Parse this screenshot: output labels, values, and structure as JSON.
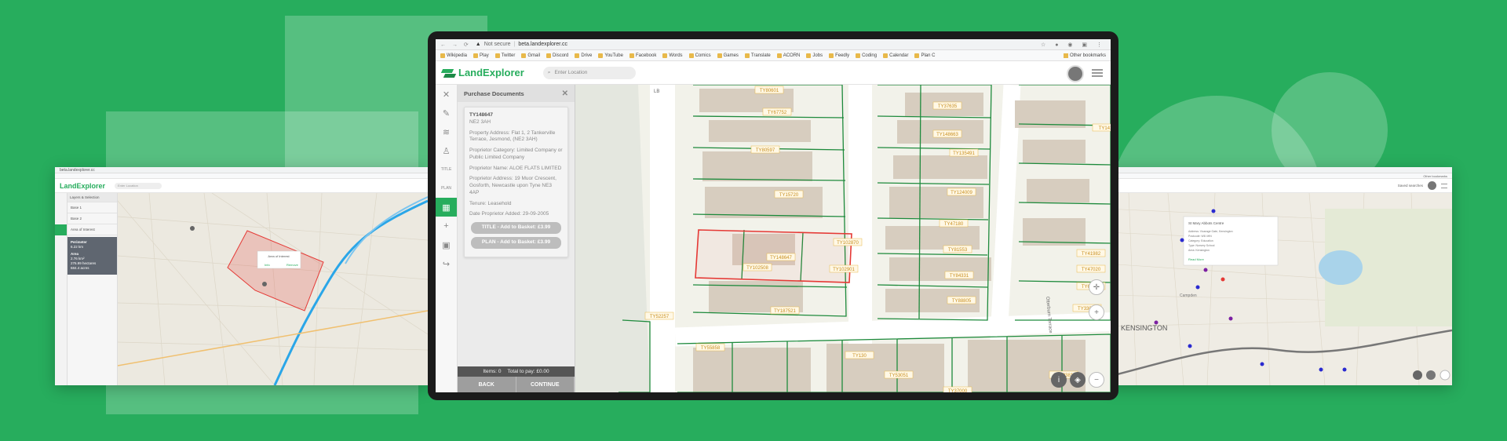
{
  "colors": {
    "brand_green": "#27ad5d",
    "parcel_green": "#1e8a3c",
    "selected_red": "#e53935"
  },
  "browser": {
    "security_label": "Not secure",
    "url": "beta.landexplorer.cc",
    "bookmarks": [
      "Wikipedia",
      "Play",
      "Twitter",
      "Gmail",
      "Discord",
      "Drive",
      "YouTube",
      "Facebook",
      "Words",
      "Comics",
      "Games",
      "Translate",
      "ACORN",
      "Jobs",
      "Feedly",
      "Coding",
      "Calendar",
      "Plan C"
    ],
    "other_bookmarks": "Other bookmarks"
  },
  "app": {
    "logo_text": "LandExplorer",
    "search_placeholder": "Enter Location"
  },
  "toolbar": {
    "tools": [
      {
        "icon": "close-icon",
        "glyph": "✕"
      },
      {
        "icon": "pencil-icon",
        "glyph": "✎"
      },
      {
        "icon": "layers-icon",
        "glyph": "≋"
      },
      {
        "icon": "person-icon",
        "glyph": "♙"
      },
      {
        "icon": "title-icon",
        "glyph": "TITLE"
      },
      {
        "icon": "plan-icon",
        "glyph": "PLAN"
      },
      {
        "icon": "basket-icon",
        "glyph": "▦"
      },
      {
        "icon": "plus-icon",
        "glyph": "+"
      },
      {
        "icon": "save-icon",
        "glyph": "▣"
      },
      {
        "icon": "share-icon",
        "glyph": "↪"
      }
    ]
  },
  "panel": {
    "title": "Purchase Documents",
    "title_number": "TY148647",
    "postcode": "NE2 3AH",
    "property_address": "Property Address: Flat 1, 2 Tankerville Terrace, Jesmond, (NE2 3AH)",
    "proprietor_category": "Proprietor Category: Limited Company or Public Limited Company",
    "proprietor_name": "Proprietor Name: ALOE FLATS LIMITED",
    "proprietor_address": "Proprietor Address: 19 Muor Crescent, Gosforth, Newcastle upon Tyne NE3 4AP",
    "tenure": "Tenure: Leasehold",
    "date_added": "Date Proprietor Added: 29-09-2005",
    "title_button": "TITLE - Add to Basket: £3.99",
    "plan_button": "PLAN - Add to Basket: £3.99",
    "basket_items": "Items: 0",
    "basket_total": "Total to pay: £0.00",
    "back_button": "BACK",
    "continue_button": "CONTINUE"
  },
  "map": {
    "street_labels": [
      "LB",
      "Otterburn Terrace"
    ],
    "parcel_labels": [
      "TY80601",
      "TY67752",
      "TY80597",
      "TY15720",
      "TY148647",
      "TY102508",
      "TY102870",
      "TY102901",
      "TY187521",
      "TY37635",
      "TY148663",
      "TY135491",
      "TY124009",
      "TY47180",
      "TY81553",
      "TY84331",
      "TY88805",
      "TY55858",
      "TY52257",
      "TY130",
      "TY41982",
      "TY47020",
      "TY64007",
      "TY33011",
      "TY53051",
      "TY37000",
      "TY1411",
      "TY49381"
    ]
  },
  "left_window": {
    "logo_text": "LandExplorer",
    "panel_rows": [
      "Layers & Selection",
      "Base 1",
      "Base 2",
      "Area of Interest"
    ],
    "measure_title": "Perimeter",
    "measure_value": "6.22 km",
    "area_title": "Area",
    "area_lines": [
      "2.76 km²",
      "276.99 hectares",
      "684.4 acres"
    ],
    "popup_title": "Area of Interest",
    "popup_actions": [
      "Info",
      "Remove"
    ]
  },
  "right_window": {
    "popup_title": "St Mary Abbots Centre",
    "popup_lines": [
      "Address: Vicarage Gate, Kensington",
      "Postcode: W8 4HN",
      "Category: Education",
      "Type: Nursery School",
      "Area: Kensington"
    ],
    "popup_link": "Read More",
    "place_label": "KENSINGTON",
    "sub_label": "Campden",
    "saved_link": "Saved searches"
  }
}
